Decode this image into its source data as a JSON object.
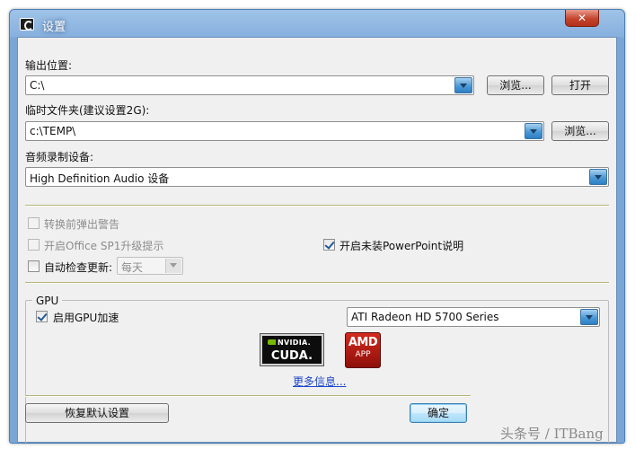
{
  "window": {
    "title": "设置",
    "close_label": "✕"
  },
  "output": {
    "label": "输出位置:",
    "value": "C:\\",
    "browse_label": "浏览...",
    "open_label": "打开"
  },
  "temp": {
    "label": "临时文件夹(建议设置2G):",
    "value": "c:\\TEMP\\",
    "browse_label": "浏览..."
  },
  "audio": {
    "label": "音频录制设备:",
    "value": "High Definition Audio 设备"
  },
  "options": {
    "warn_before_convert": {
      "label": "转换前弹出警告",
      "checked": false,
      "enabled": false
    },
    "office_sp1_prompt": {
      "label": "开启Office SP1升级提示",
      "checked": false,
      "enabled": false
    },
    "powerpoint_notice": {
      "label": "开启未装PowerPoint说明",
      "checked": true,
      "enabled": true
    },
    "auto_update": {
      "label": "自动检查更新:",
      "checked": false,
      "enabled": true,
      "frequency": "每天"
    }
  },
  "gpu": {
    "group_title": "GPU",
    "accel_label": "启用GPU加速",
    "accel_checked": true,
    "device": "ATI Radeon HD 5700 Series",
    "nvidia_brand": "NVIDIA.",
    "nvidia_product": "CUDA.",
    "amd_brand": "AMD",
    "amd_product": "APP",
    "more_info": "更多信息..."
  },
  "footer": {
    "reset_label": "恢复默认设置",
    "ok_label": "确定"
  },
  "watermark": "头条号 / ITBang"
}
